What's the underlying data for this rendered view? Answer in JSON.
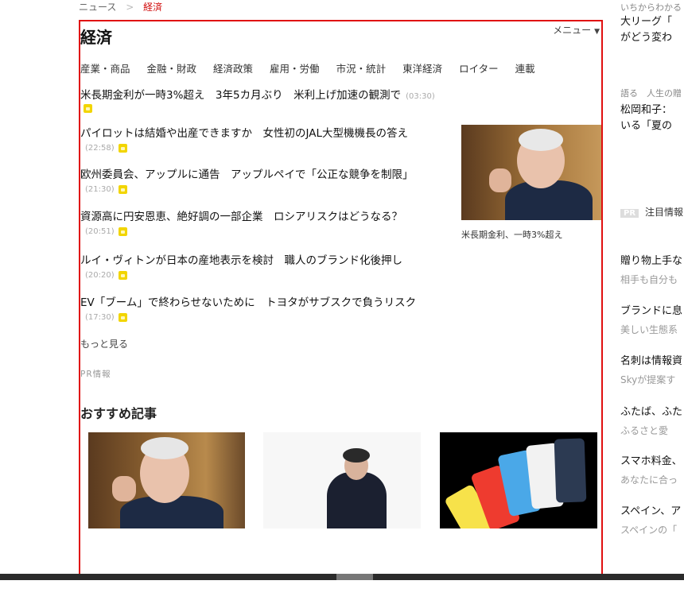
{
  "breadcrumb": {
    "home": "ニュース",
    "sep": ">",
    "current": "経済"
  },
  "page": {
    "title": "経済",
    "menu_label": "メニュー",
    "menu_arrow": "▼"
  },
  "categories": [
    "産業・商品",
    "金融・財政",
    "経済政策",
    "雇用・労働",
    "市況・統計",
    "東洋経済",
    "ロイター",
    "連載"
  ],
  "headlines": [
    {
      "title": "米長期金利が一時3%超え　3年5カ月ぶり　米利上げ加速の観測で",
      "time": "(03:30)"
    },
    {
      "title": "パイロットは結婚や出産できますか　女性初のJAL大型機機長の答え",
      "time": "(22:58)"
    },
    {
      "title": "欧州委員会、アップルに通告　アップルペイで「公正な競争を制限」",
      "time": "(21:30)"
    },
    {
      "title": "資源高に円安恩恵、絶好調の一部企業　ロシアリスクはどうなる？",
      "time": "(20:51)"
    },
    {
      "title": "ルイ・ヴィトンが日本の産地表示を検討　職人のブランド化後押し",
      "time": "(20:20)"
    },
    {
      "title": "EV「ブーム」で終わらせないために　トヨタがサブスクで負うリスク",
      "time": "(17:30)"
    }
  ],
  "featured": {
    "caption": "米長期金利、一時3%超え"
  },
  "more_label": "もっと見る",
  "pr_label": "PR情報",
  "recommended": {
    "heading": "おすすめ記事"
  },
  "right_column": {
    "top_small": "いちからわかる",
    "top_title_1": "大リーグ「",
    "top_title_2": "がどう変わ",
    "section_small": "語る　人生の贈",
    "section_title_1": "松岡和子：",
    "section_title_2": "いる「夏の",
    "pr_badge": "PR",
    "pr_text": "注目情報",
    "items": [
      {
        "title": "贈り物上手な",
        "sub": "相手も自分も"
      },
      {
        "title": "ブランドに息",
        "sub": "美しい生態系"
      },
      {
        "title": "名刺は情報資",
        "sub": "Skyが提案す"
      },
      {
        "title": "ふたば、ふた",
        "sub": "ふるさと愛"
      },
      {
        "title": "スマホ料金、",
        "sub": "あなたに合っ"
      },
      {
        "title": "スペイン、ア",
        "sub": "スペインの「"
      }
    ]
  }
}
